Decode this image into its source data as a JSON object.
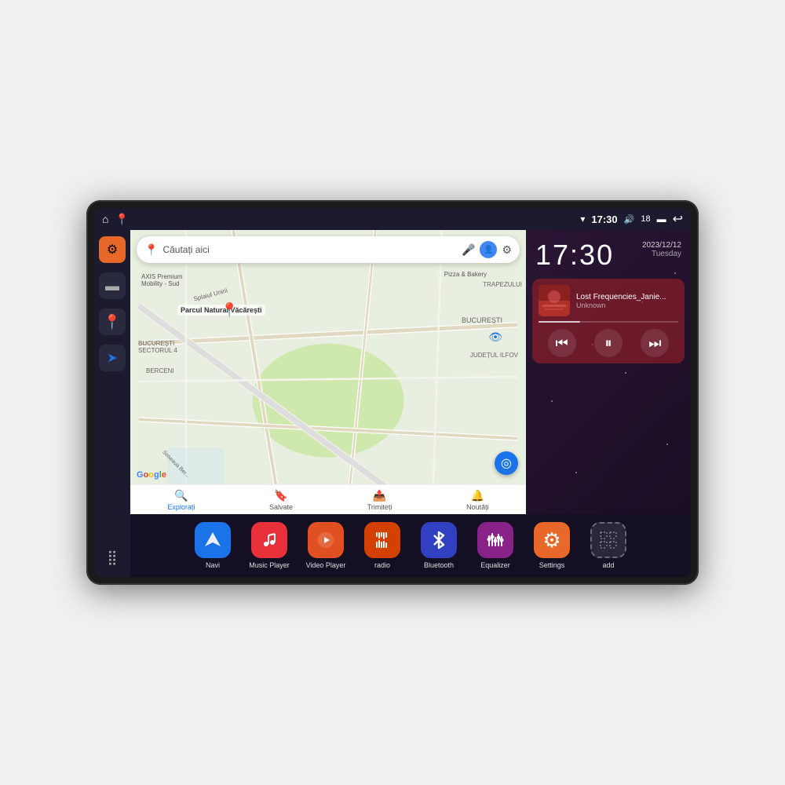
{
  "device": {
    "status_bar": {
      "wifi_icon": "▾",
      "time": "17:30",
      "volume_icon": "🔊",
      "battery_level": "18",
      "battery_icon": "🔋",
      "back_icon": "↩"
    },
    "sidebar": {
      "settings_label": "Settings",
      "folder_label": "Folder",
      "location_label": "Location",
      "grid_label": "Apps"
    },
    "map": {
      "search_placeholder": "Căutați aici",
      "location_labels": [
        "AXIS Premium Mobility - Sud",
        "Pizza & Bakery",
        "Parcul Natural Văcărești",
        "BUCUREȘTI",
        "BUCUREȘTI SECTORUL 4",
        "BERCENI",
        "JUDEȚUL ILFOV",
        "TRAPEZULUI"
      ],
      "tabs": [
        {
          "label": "Explorați",
          "icon": "🔍",
          "active": true
        },
        {
          "label": "Salvate",
          "icon": "🔖",
          "active": false
        },
        {
          "label": "Trimiteți",
          "icon": "📤",
          "active": false
        },
        {
          "label": "Noutăți",
          "icon": "🔔",
          "active": false
        }
      ]
    },
    "clock": {
      "time": "17:30",
      "date": "2023/12/12",
      "day": "Tuesday"
    },
    "music": {
      "title": "Lost Frequencies_Janie...",
      "artist": "Unknown",
      "album_art_emoji": "🎵"
    },
    "apps": [
      {
        "id": "navi",
        "label": "Navi",
        "icon": "➤",
        "color": "app-navi"
      },
      {
        "id": "music",
        "label": "Music Player",
        "icon": "♪",
        "color": "app-music"
      },
      {
        "id": "video",
        "label": "Video Player",
        "icon": "▶",
        "color": "app-video"
      },
      {
        "id": "radio",
        "label": "radio",
        "icon": "📶",
        "color": "app-radio"
      },
      {
        "id": "bluetooth",
        "label": "Bluetooth",
        "icon": "₿",
        "color": "app-bluetooth"
      },
      {
        "id": "equalizer",
        "label": "Equalizer",
        "icon": "🎚",
        "color": "app-eq"
      },
      {
        "id": "settings",
        "label": "Settings",
        "icon": "⚙",
        "color": "app-settings"
      },
      {
        "id": "add",
        "label": "add",
        "icon": "+",
        "color": "app-add"
      }
    ]
  }
}
